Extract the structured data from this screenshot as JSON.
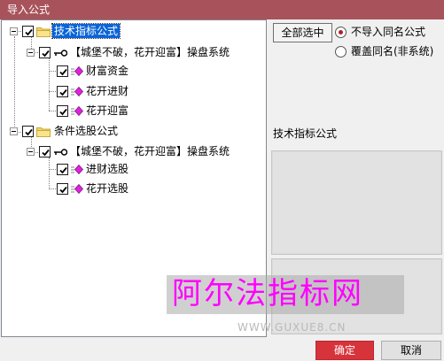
{
  "window": {
    "title": "导入公式"
  },
  "tree": {
    "groups": [
      {
        "label": "技术指标公式",
        "checked": true,
        "systems": [
          {
            "label": "【城堡不破，花开迎富】操盘系统",
            "checked": true,
            "formulas": [
              {
                "label": "财富资金",
                "checked": true
              },
              {
                "label": "花开进财",
                "checked": true
              },
              {
                "label": "花开迎富",
                "checked": true
              }
            ]
          }
        ]
      },
      {
        "label": "条件选股公式",
        "checked": true,
        "systems": [
          {
            "label": "【城堡不破，花开迎富】操盘系统",
            "checked": true,
            "formulas": [
              {
                "label": "进财选股",
                "checked": true
              },
              {
                "label": "花开选股",
                "checked": true
              }
            ]
          }
        ]
      }
    ]
  },
  "options": {
    "select_all_label": "全部选中",
    "radio_no_import_same": "不导入同名公式",
    "radio_overwrite_same": "覆盖同名(非系统)",
    "selected": "no_import_same"
  },
  "description": {
    "label": "技术指标公式"
  },
  "buttons": {
    "ok": "确定",
    "cancel": "取消"
  },
  "watermark": {
    "text": "阿尔法指标网",
    "url": "WWW.GUXUE8.CN"
  },
  "colors": {
    "titlebar": "#a8535b",
    "selection": "#0a64d8",
    "ok_button": "#d7333b",
    "formula_icon": "#e020e0",
    "watermark_text": "#ff00ff"
  }
}
